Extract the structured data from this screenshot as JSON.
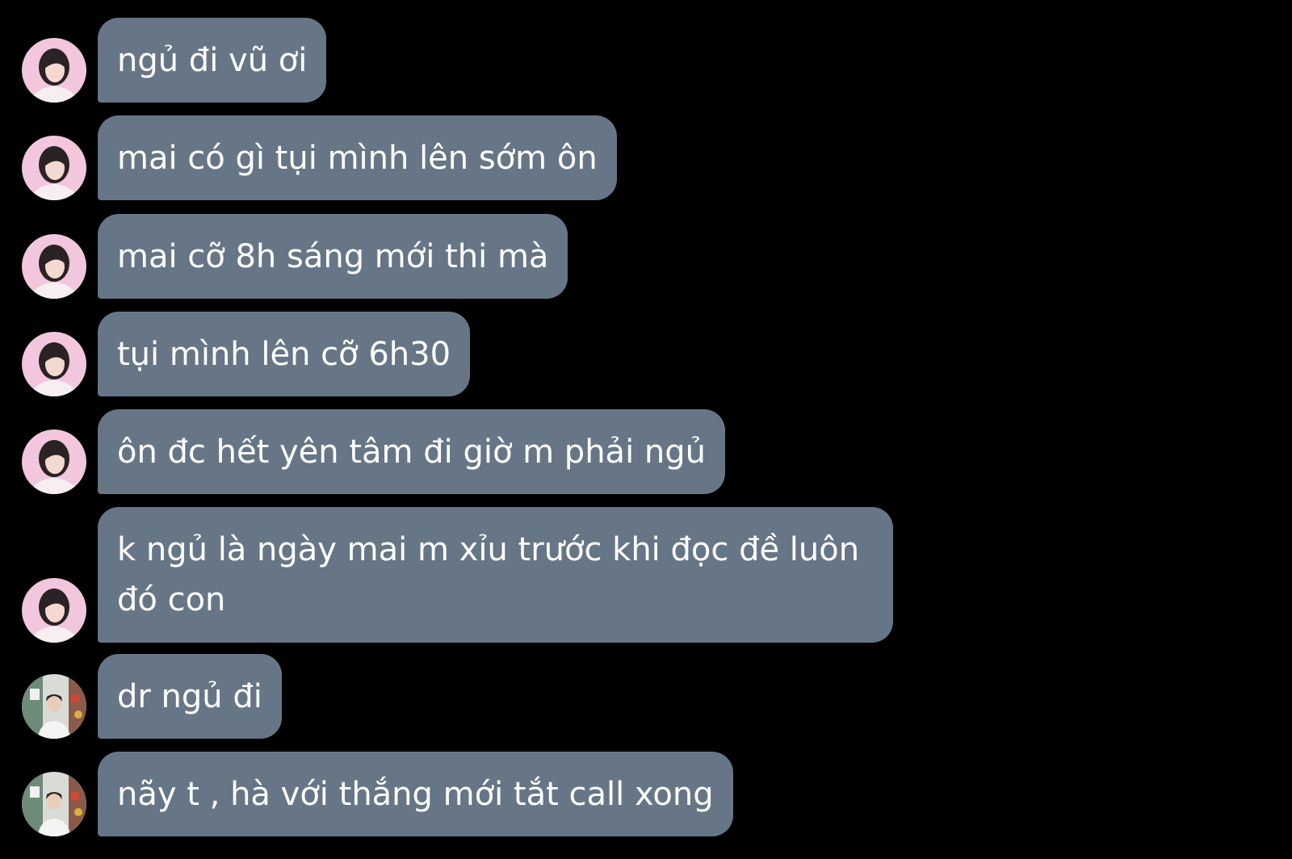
{
  "conversation": {
    "messages": [
      {
        "sender": "friend-a",
        "text": "ngủ đi vũ ơi"
      },
      {
        "sender": "friend-a",
        "text": "mai có gì tụi mình lên sớm ôn"
      },
      {
        "sender": "friend-a",
        "text": "mai cỡ 8h sáng mới thi mà"
      },
      {
        "sender": "friend-a",
        "text": "tụi mình lên cỡ 6h30"
      },
      {
        "sender": "friend-a",
        "text": "ôn đc hết yên tâm đi giờ m phải ngủ"
      },
      {
        "sender": "friend-a",
        "text": "k ngủ là ngày mai m xỉu trước khi đọc đề luôn đó con"
      },
      {
        "sender": "friend-b",
        "text": "dr ngủ đi"
      },
      {
        "sender": "friend-b",
        "text": "nãy t , hà với thắng mới tắt call xong"
      }
    ]
  },
  "colors": {
    "background": "#000000",
    "bubble": "#667687",
    "text": "#ffffff"
  },
  "icons": {
    "avatar_a": "avatar-pink-portrait",
    "avatar_b": "avatar-photo-portrait"
  }
}
